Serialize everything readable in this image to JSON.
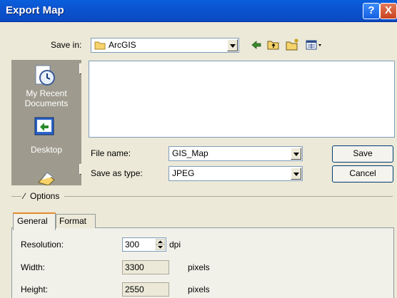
{
  "window": {
    "title": "Export Map"
  },
  "title_buttons": {
    "help": "?",
    "close": "X"
  },
  "save_in": {
    "label": "Save in:",
    "value": "ArcGIS"
  },
  "places": {
    "recent": "My Recent\nDocuments",
    "desktop": "Desktop"
  },
  "file_name": {
    "label": "File name:",
    "value": "GIS_Map"
  },
  "save_as_type": {
    "label": "Save as type:",
    "value": "JPEG"
  },
  "buttons": {
    "save": "Save",
    "cancel": "Cancel"
  },
  "options": {
    "label": "Options",
    "toggle": "∕"
  },
  "tabs": [
    {
      "label": "General"
    },
    {
      "label": "Format"
    }
  ],
  "general": {
    "resolution": {
      "label": "Resolution:",
      "value": "300",
      "unit": "dpi"
    },
    "width": {
      "label": "Width:",
      "value": "3300",
      "unit": "pixels"
    },
    "height": {
      "label": "Height:",
      "value": "2550",
      "unit": "pixels"
    }
  }
}
